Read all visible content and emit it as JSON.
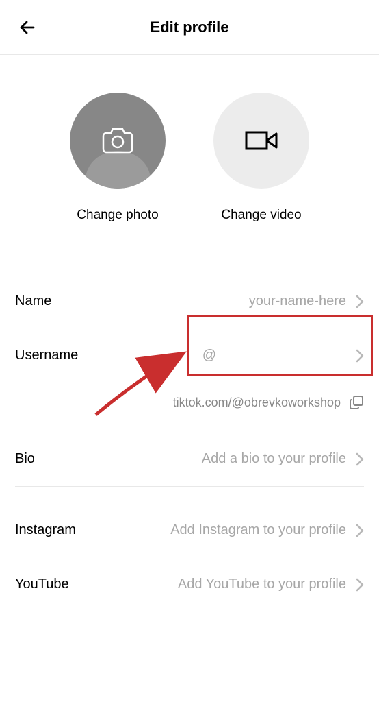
{
  "header": {
    "title": "Edit profile"
  },
  "media": {
    "photo_label": "Change photo",
    "video_label": "Change video"
  },
  "fields": {
    "name": {
      "label": "Name",
      "value": "your-name-here"
    },
    "username": {
      "label": "Username",
      "value": "@"
    },
    "url": "tiktok.com/@obrevkoworkshop",
    "bio": {
      "label": "Bio",
      "value": "Add a bio to your profile"
    },
    "instagram": {
      "label": "Instagram",
      "value": "Add Instagram to your profile"
    },
    "youtube": {
      "label": "YouTube",
      "value": "Add YouTube to your profile"
    }
  },
  "annotation": {
    "highlight_color": "#c92e2e"
  }
}
